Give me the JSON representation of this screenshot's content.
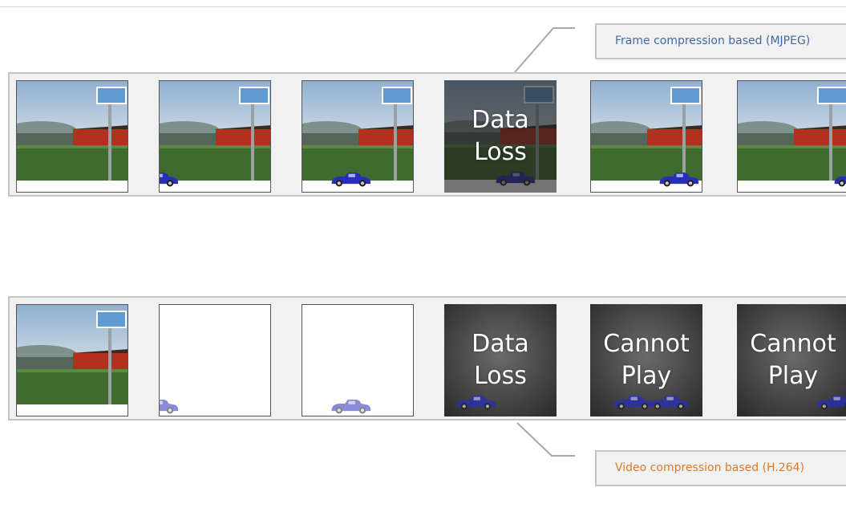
{
  "labels": {
    "top": "Frame compression based (MJPEG)",
    "bottom": "Video compression based (H.264)"
  },
  "rows": [
    {
      "name": "mjpeg",
      "frames": [
        {
          "kind": "photo",
          "car": 0.0,
          "car_visible": 0.15
        },
        {
          "kind": "photo",
          "car": 0.0,
          "car_visible": 0.55
        },
        {
          "kind": "photo",
          "car": 0.25,
          "car_visible": 1.0
        },
        {
          "kind": "loss",
          "text": "Data\nLoss",
          "car": 0.45,
          "car_visible": 1.0
        },
        {
          "kind": "photo",
          "car": 0.6,
          "car_visible": 1.0
        },
        {
          "kind": "photo",
          "car": 0.85,
          "car_visible": 0.5
        }
      ]
    },
    {
      "name": "h264",
      "frames": [
        {
          "kind": "photo",
          "car": 0.0,
          "car_visible": 0.15
        },
        {
          "kind": "blank",
          "car": 0.0,
          "car_visible": 0.55
        },
        {
          "kind": "blank",
          "car": 0.25,
          "car_visible": 1.0
        },
        {
          "kind": "loss",
          "text": "Data\nLoss",
          "car": 0.1,
          "car_visible": 1.0
        },
        {
          "kind": "cannot",
          "text": "Cannot\nPlay",
          "car": 0.2,
          "car_visible": 1.0
        },
        {
          "kind": "cannot",
          "text": "Cannot\nPlay",
          "car": 0.7,
          "car_visible": 0.5
        }
      ]
    }
  ],
  "colors": {
    "sky": "#a9c1da",
    "field": "#3f6b2e",
    "barn": "#b2301e",
    "car": "#2a2db8",
    "dark": "#3a3a3a"
  }
}
